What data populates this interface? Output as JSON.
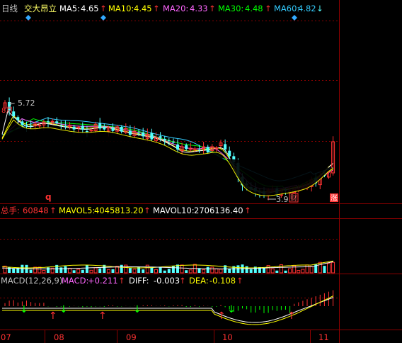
{
  "header": {
    "period": "日线",
    "stock_name": "交大昂立",
    "ma": [
      {
        "label": "MA5:",
        "value": "4.65",
        "dir": "up",
        "color": "#ffffff"
      },
      {
        "label": "MA10:",
        "value": "4.45",
        "dir": "up",
        "color": "#ffff00"
      },
      {
        "label": "MA20:",
        "value": "4.33",
        "dir": "up",
        "color": "#ff66ff"
      },
      {
        "label": "MA30:",
        "value": "4.48",
        "dir": "up",
        "color": "#00ff00"
      },
      {
        "label": "MA60:",
        "value": "4.82",
        "dir": "down",
        "color": "#33ccff"
      }
    ]
  },
  "price_panel": {
    "high_label": "5.72",
    "low_label": "3.95",
    "low_tag": "财",
    "rise_tag": "涨",
    "q_marker": "q"
  },
  "volume_panel": {
    "total_label": "总手:",
    "total_value": "60848",
    "mavol5_label": "MAVOL5:",
    "mavol5_value": "4045813.20",
    "mavol10_label": "MAVOL10:",
    "mavol10_value": "2706136.40"
  },
  "macd_panel": {
    "name": "MACD(12,26,9)",
    "macd_label": "MACD:",
    "macd_value": "+0.211",
    "diff_label": "DIFF:",
    "diff_value": "-0.003",
    "dea_label": "DEA:",
    "dea_value": "-0.108"
  },
  "x_axis": {
    "months": [
      "07",
      "08",
      "09",
      "10",
      "11"
    ]
  },
  "colors": {
    "up": "#ff3232",
    "down": "#54ffff",
    "ma5": "#ffffff",
    "ma10": "#ffff00",
    "ma20": "#ff66ff",
    "ma30": "#00ff00",
    "ma60": "#33ccff",
    "grid": "#8b0000",
    "diamond": "#33aaff"
  },
  "chart_data": {
    "type": "candlestick",
    "title": "交大昂立",
    "x_labels": [
      "07",
      "08",
      "09",
      "10",
      "11"
    ],
    "price_high": 5.72,
    "price_low": 3.95,
    "last_ma": {
      "MA5": 4.65,
      "MA10": 4.45,
      "MA20": 4.33,
      "MA30": 4.48,
      "MA60": 4.82
    },
    "volume": {
      "total": 60848,
      "MAVOL5": 4045813.2,
      "MAVOL10": 2706136.4
    },
    "macd": {
      "MACD": 0.211,
      "DIFF": -0.003,
      "DEA": -0.108
    }
  }
}
